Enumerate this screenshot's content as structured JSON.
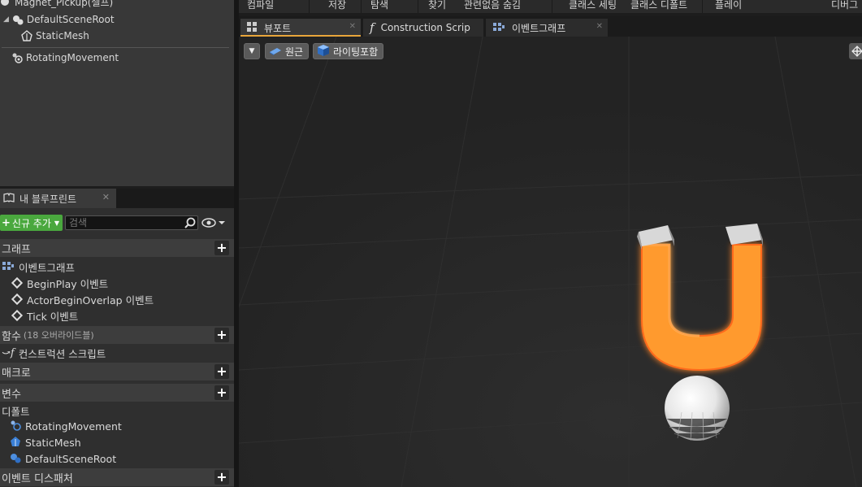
{
  "components": {
    "partial_top_label": "Magnet_Pickup(셀프)",
    "items": [
      {
        "label": "DefaultSceneRoot"
      },
      {
        "label": "StaticMesh"
      },
      {
        "label": "RotatingMovement"
      }
    ]
  },
  "my_blueprint": {
    "tab_label": "내 블루프린트",
    "add_new_label": "신규 추가",
    "search_placeholder": "검색",
    "sections": {
      "graphs": {
        "label": "그래프"
      },
      "event_graph": {
        "label": "이벤트그래프"
      },
      "events": [
        {
          "label": "BeginPlay 이벤트"
        },
        {
          "label": "ActorBeginOverlap 이벤트"
        },
        {
          "label": "Tick 이벤트"
        }
      ],
      "functions": {
        "label": "함수",
        "sub": "(18 오버라이드블)"
      },
      "construction_script": {
        "label": "컨스트럭션 스크립트"
      },
      "macros": {
        "label": "매크로"
      },
      "variables": {
        "label": "변수"
      },
      "defaults_category": {
        "label": "디폴트"
      },
      "variable_items": [
        {
          "label": "RotatingMovement"
        },
        {
          "label": "StaticMesh"
        },
        {
          "label": "DefaultSceneRoot"
        }
      ],
      "event_dispatchers": {
        "label": "이벤트 디스패처"
      }
    }
  },
  "menubar": {
    "items": [
      "컴파일",
      "저장",
      "탐색",
      "찾기",
      "관련없음 숨김",
      "클래스 세팅",
      "클래스 디폴트",
      "플레이",
      "디버그"
    ]
  },
  "editor_tabs": [
    {
      "label": "뷰포트"
    },
    {
      "label": "Construction Scrip"
    },
    {
      "label": "이벤트그래프"
    }
  ],
  "viewport": {
    "perspective_label": "원근",
    "lighting_label": "라이팅포함"
  },
  "colors": {
    "accent_tab": "#e8a53b",
    "add_button": "#4aa83e",
    "magnet_orange": "#ff9a2e"
  },
  "icons": [
    "close-icon",
    "search-icon",
    "eye-icon",
    "plus-icon",
    "diamond-event-icon",
    "function-icon",
    "graph-icon"
  ]
}
